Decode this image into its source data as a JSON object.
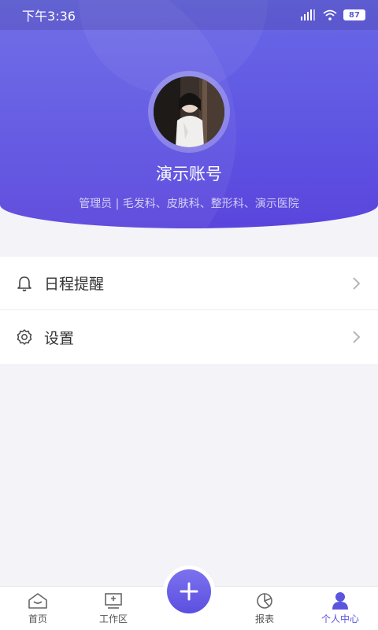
{
  "statusbar": {
    "time": "下午3:36",
    "battery": "87"
  },
  "profile": {
    "name": "演示账号",
    "subtitle": "管理员 | 毛发科、皮肤科、整形科、演示医院"
  },
  "menu": {
    "items": [
      {
        "label": "日程提醒",
        "icon": "bell-icon"
      },
      {
        "label": "设置",
        "icon": "gear-icon"
      }
    ]
  },
  "tabbar": {
    "tabs": [
      {
        "label": "首页",
        "icon": "home-icon"
      },
      {
        "label": "工作区",
        "icon": "workspace-icon"
      },
      {
        "label": "报表",
        "icon": "pie-chart-icon"
      },
      {
        "label": "个人中心",
        "icon": "user-icon"
      }
    ],
    "fab_icon": "plus-icon"
  },
  "colors": {
    "accent": "#5b55de",
    "header_top": "#6a68e6",
    "header_bottom": "#5a45dc",
    "background": "#f3f3f8"
  }
}
